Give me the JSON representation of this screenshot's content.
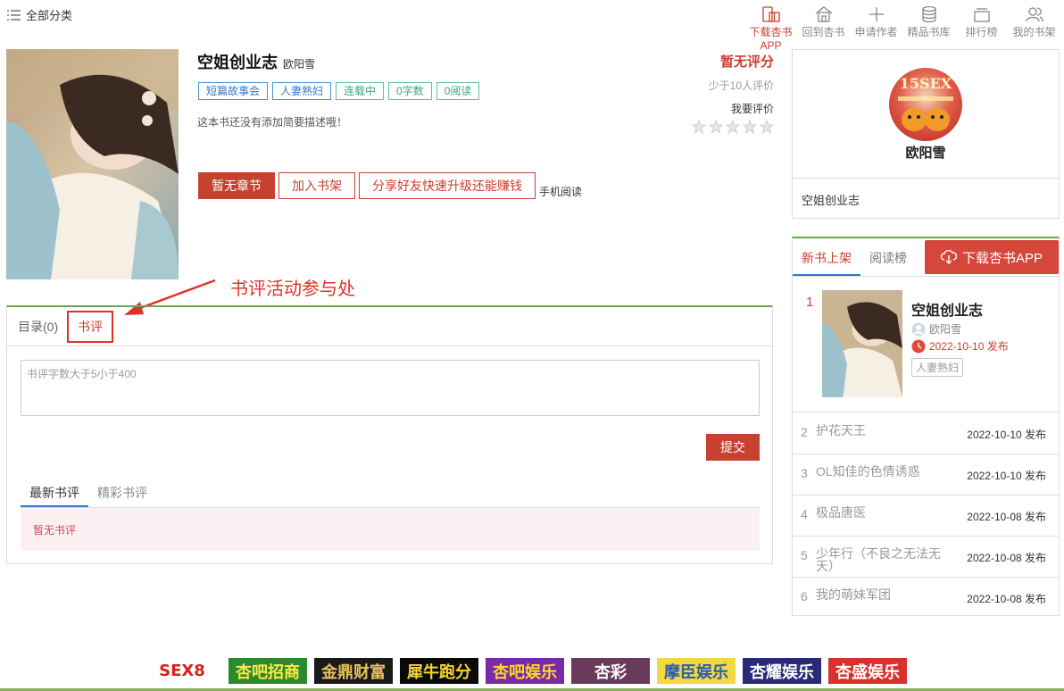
{
  "topbar": {
    "all_categories": "全部分类",
    "nav": [
      {
        "label": "下载杏书APP",
        "icon": "phone-book-icon",
        "active": true
      },
      {
        "label": "回到杏书",
        "icon": "home-icon",
        "active": false
      },
      {
        "label": "申请作者",
        "icon": "plus-icon",
        "active": false
      },
      {
        "label": "精品书库",
        "icon": "database-icon",
        "active": false
      },
      {
        "label": "排行榜",
        "icon": "ranking-icon",
        "active": false
      },
      {
        "label": "我的书架",
        "icon": "user-icon",
        "active": false
      }
    ]
  },
  "book": {
    "title": "空姐创业志",
    "author": "欧阳雪",
    "tags": [
      "短篇故事会",
      "人妻熟妇",
      "连载中",
      "0字数",
      "0阅读"
    ],
    "intro": "这本书还没有添加简要描述哦！",
    "rating_none": "暂无评分",
    "rating_few": "少于10人评价",
    "rate_label": "我要评价",
    "stars": 5
  },
  "actions": {
    "no_chapter": "暂无章节",
    "add_shelf": "加入书架",
    "share": "分享好友快速升级还能赚钱",
    "mobile_read": "手机阅读"
  },
  "annotation": "书评活动参与处",
  "content": {
    "tab_toc": "目录(0)",
    "tab_review": "书评",
    "placeholder": "书评字数大于5小于400",
    "submit": "提交",
    "sub_latest": "最新书评",
    "sub_featured": "精彩书评",
    "empty": "暂无书评"
  },
  "author_box": {
    "avatar_text": "15SEX",
    "name": "欧阳雪",
    "book": "空姐创业志"
  },
  "rank": {
    "tab_new": "新书上架",
    "tab_read": "阅读榜",
    "download": "下载杏书APP",
    "top1": {
      "num": "1",
      "title": "空姐创业志",
      "author": "欧阳雪",
      "date": "2022-10-10 发布",
      "tag": "人妻熟妇"
    },
    "items": [
      {
        "num": "2",
        "name": "护花天王",
        "date": "2022-10-10 发布"
      },
      {
        "num": "3",
        "name": "OL知佳的色情诱惑",
        "date": "2022-10-10 发布"
      },
      {
        "num": "4",
        "name": "极品唐医",
        "date": "2022-10-08 发布"
      },
      {
        "num": "5",
        "name": "少年行（不良之无法无天）",
        "date": "2022-10-08 发布"
      },
      {
        "num": "6",
        "name": "我的萌妹军团",
        "date": "2022-10-08 发布"
      }
    ]
  },
  "banners": [
    {
      "text": "SEX8",
      "bg": "#ffffff",
      "fg": "#d8201a"
    },
    {
      "text": "杏吧招商",
      "bg": "#2b8a2b",
      "fg": "#ffe84a"
    },
    {
      "text": "金鼎财富",
      "bg": "#1a1a1a",
      "fg": "#e8c060"
    },
    {
      "text": "犀牛跑分",
      "bg": "#0a0a0a",
      "fg": "#f8d830"
    },
    {
      "text": "杏吧娱乐",
      "bg": "#7a2aa8",
      "fg": "#ffd820"
    },
    {
      "text": "杏彩",
      "bg": "#6a3a5a",
      "fg": "#ffffff"
    },
    {
      "text": "摩臣娱乐",
      "bg": "#f4d840",
      "fg": "#2a5ab8"
    },
    {
      "text": "杏耀娱乐",
      "bg": "#2a2a7a",
      "fg": "#ffffff"
    },
    {
      "text": "杏盛娱乐",
      "bg": "#d8302a",
      "fg": "#ffffff"
    }
  ]
}
